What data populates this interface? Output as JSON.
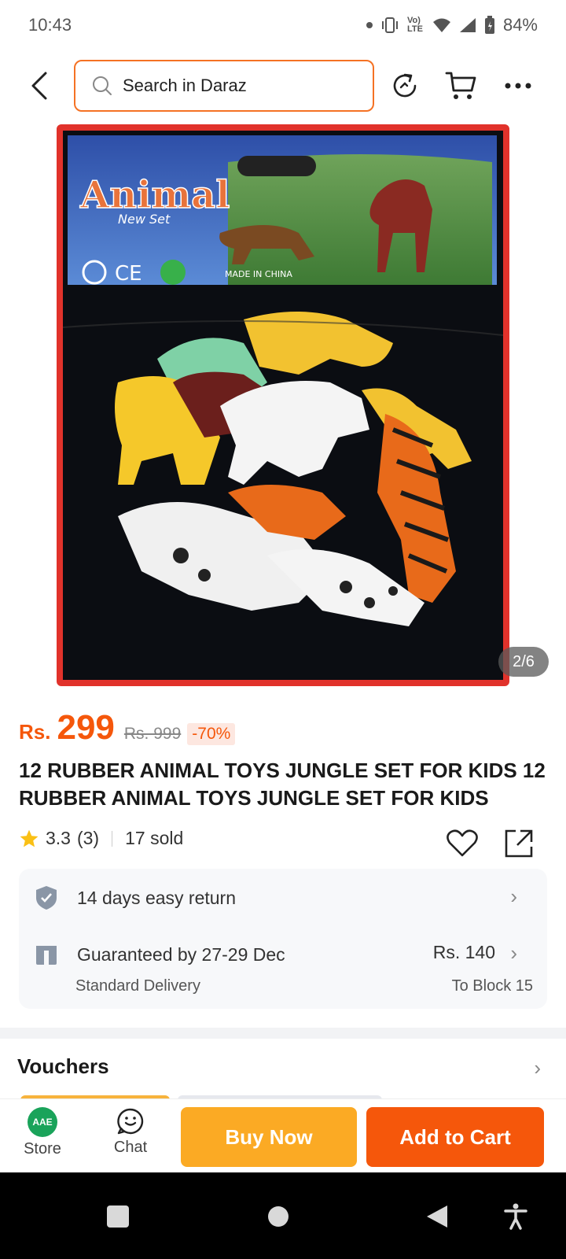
{
  "status_bar": {
    "time": "10:43",
    "battery": "84%",
    "network_label": "Vo) LTE"
  },
  "search": {
    "placeholder": "Search in Daraz"
  },
  "gallery": {
    "counter": "2/6"
  },
  "price": {
    "currency": "Rs.",
    "amount": "299",
    "original": "Rs. 999",
    "discount": "-70%"
  },
  "product": {
    "title": "12 RUBBER ANIMAL TOYS JUNGLE SET FOR KIDS 12 RUBBER ANIMAL TOYS JUNGLE SET FOR KIDS"
  },
  "rating": {
    "score": "3.3",
    "count": "(3)",
    "sold": "17 sold"
  },
  "delivery": {
    "return_label": "14 days easy return",
    "guarantee_label": "Guaranteed by 27-29 Dec",
    "method": "Standard Delivery",
    "fee": "Rs. 140",
    "destination": "To Block 15"
  },
  "vouchers": {
    "title": "Vouchers"
  },
  "image_text": {
    "brand": "Animal",
    "subtitle": "New Set",
    "origin": "MADE IN CHINA",
    "mark": "CE"
  },
  "bottom_bar": {
    "store_label": "Store",
    "store_logo": "AAE",
    "chat_label": "Chat",
    "buy_now": "Buy Now",
    "add_to_cart": "Add to Cart"
  },
  "colors": {
    "accent": "#f5570b",
    "buy_now": "#fbaa24",
    "frame": "#e1322b",
    "store_logo": "#1aa35a"
  }
}
